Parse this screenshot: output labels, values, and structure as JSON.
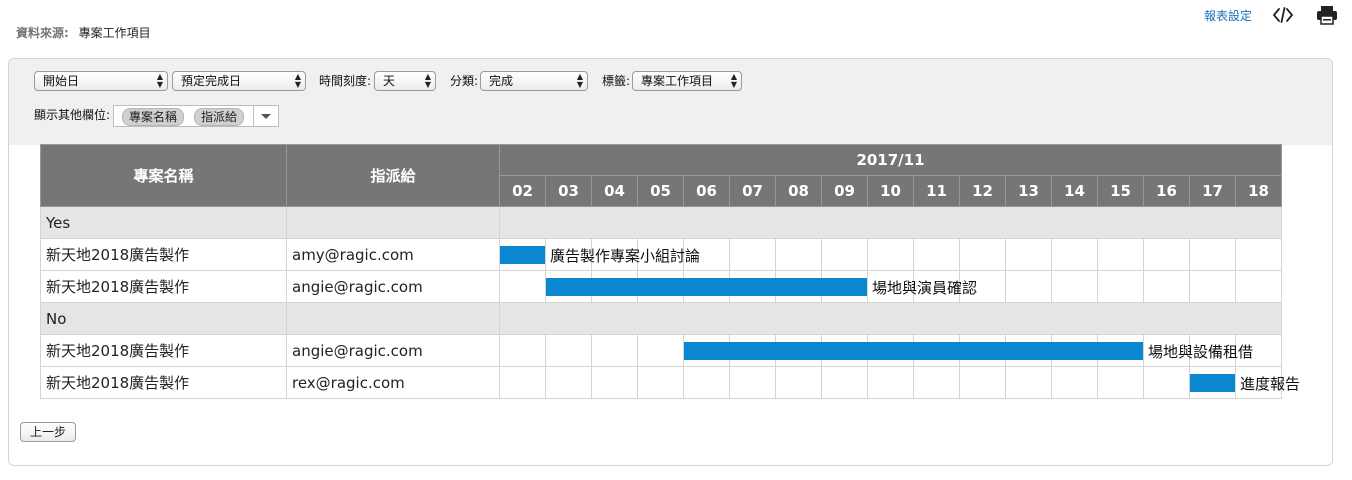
{
  "header": {
    "source_label": "資料來源:",
    "source_value": "專案工作項目",
    "report_settings": "報表設定",
    "embed_icon": "code-icon",
    "print_icon": "printer-icon"
  },
  "filters": {
    "start_field": "開始日",
    "end_field": "預定完成日",
    "time_scale_label": "時間刻度:",
    "time_scale_value": "天",
    "category_label": "分類:",
    "category_value": "完成",
    "tag_label": "標籤:",
    "tag_value": "專案工作項目",
    "other_fields_label": "顯示其他欄位:",
    "other_fields_tags": [
      "專案名稱",
      "指派給"
    ]
  },
  "gantt": {
    "col_project": "專案名稱",
    "col_assignee": "指派給",
    "month": "2017/11",
    "days": [
      "02",
      "03",
      "04",
      "05",
      "06",
      "07",
      "08",
      "09",
      "10",
      "11",
      "12",
      "13",
      "14",
      "15",
      "16",
      "17",
      "18"
    ],
    "groups": [
      {
        "name": "Yes",
        "rows": [
          {
            "project": "新天地2018廣告製作",
            "assignee": "amy@ragic.com",
            "task": "廣告製作專案小組討論",
            "start": "02",
            "end": "02"
          },
          {
            "project": "新天地2018廣告製作",
            "assignee": "angie@ragic.com",
            "task": "場地與演員確認",
            "start": "03",
            "end": "09"
          }
        ]
      },
      {
        "name": "No",
        "rows": [
          {
            "project": "新天地2018廣告製作",
            "assignee": "angie@ragic.com",
            "task": "場地與設備租借",
            "start": "06",
            "end": "15"
          },
          {
            "project": "新天地2018廣告製作",
            "assignee": "rex@ragic.com",
            "task": "進度報告",
            "start": "17",
            "end": "17"
          }
        ]
      }
    ],
    "bar_color": "#0a87cf",
    "header_color": "#767676"
  },
  "footer": {
    "back_button": "上一步"
  }
}
